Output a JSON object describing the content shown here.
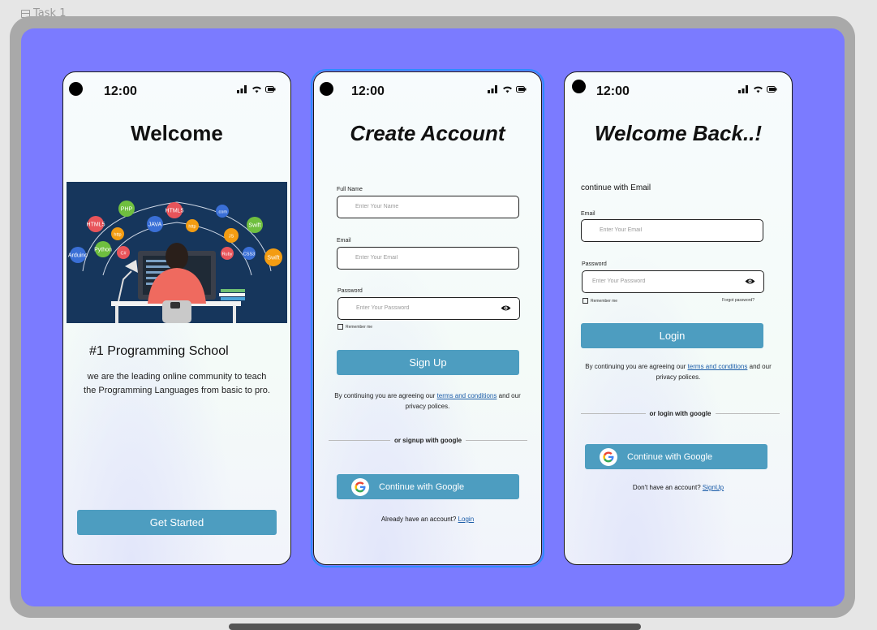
{
  "canvas": {
    "frame_label": "Task 1"
  },
  "status": {
    "time": "12:00"
  },
  "welcome": {
    "title": "Welcome",
    "hero_tags": [
      "PHP",
      "HTML5",
      "JAVA",
      "HTML5",
      "http",
      "Python",
      "C#",
      "JS",
      "Swift",
      "Ruby",
      "CSS3",
      "Swift",
      "Arduino",
      ".com",
      "http"
    ],
    "subhead": "#1 Programming School",
    "description": "we are the leading online community to teach the Programming Languages from basic to pro.",
    "button": "Get Started"
  },
  "signup": {
    "title": "Create Account",
    "fullname_label": "Full Name",
    "fullname_placeholder": "Enter Your Name",
    "email_label": "Email",
    "email_placeholder": "Enter Your Email",
    "password_label": "Password",
    "password_placeholder": "Enter Your Password",
    "remember": "Remember me",
    "button": "Sign Up",
    "legal_prefix": "By continuing you are agreeing our ",
    "legal_link": "terms and conditions",
    "legal_suffix": " and our privacy polices.",
    "divider": "or signup with google",
    "google_button": "Continue with Google",
    "account_prefix": "Already have an account? ",
    "account_link": "Login"
  },
  "login": {
    "title": "Welcome Back..!",
    "continue_text": "continue with Email",
    "email_label": "Email",
    "email_placeholder": "Enter Your Email",
    "password_label": "Password",
    "password_placeholder": "Enter Your Password",
    "remember": "Remember me",
    "forgot": "Forgot password?",
    "button": "Login",
    "legal_prefix": "By continuing you are agreeing our ",
    "legal_link": "terms and conditions",
    "legal_suffix": " and our privacy polices.",
    "divider": "or login with google",
    "google_button": "Continue with Google",
    "account_prefix": "Don't have an account? ",
    "account_link": "SignUp"
  },
  "colors": {
    "canvas_bg": "#7b7bff",
    "button": "#4d9dc0",
    "link": "#1a5ca8",
    "selection": "#2d8cff"
  }
}
